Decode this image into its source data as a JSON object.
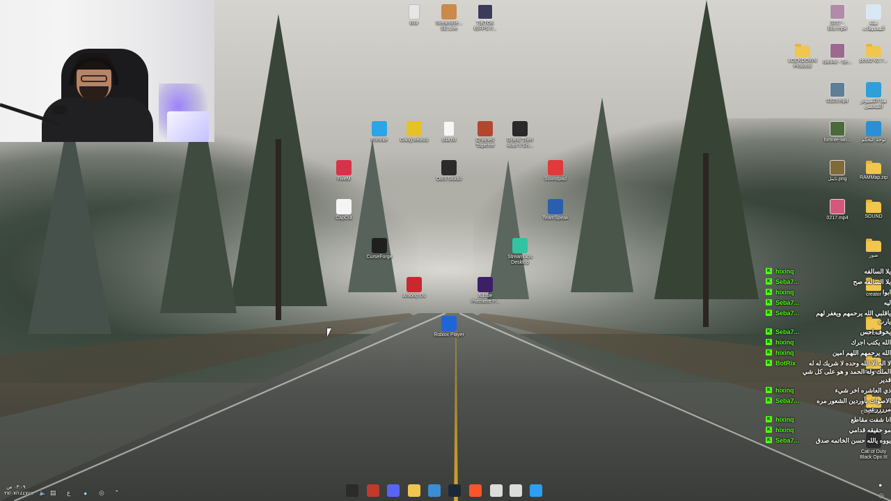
{
  "desktop": {
    "icons": [
      {
        "label": "Blur",
        "kind": "doc",
        "color": "#e6e6e6"
      },
      {
        "label": "StreamEle...\nSE.Live",
        "kind": "app",
        "color": "#c98a4a"
      },
      {
        "label": "TIKTOK\n60FPS F...",
        "kind": "vid",
        "color": "#3b3b5a"
      },
      {
        "label": "0217 -\nBlur.mp4",
        "kind": "vid",
        "color": "#b08ca8"
      },
      {
        "label": "سلة\nالمحذوفات",
        "kind": "app",
        "color": "#d9e8f2"
      },
      {
        "label": "LOCKDOWN\nProtocol",
        "kind": "folder",
        "color": "#f0c64e"
      },
      {
        "label": "dani4x - Se...",
        "kind": "vid",
        "color": "#9c6a8f"
      },
      {
        "label": "pcsx2-v2.7...",
        "kind": "folder",
        "color": "#f0c64e"
      },
      {
        "label": "0223.mp4",
        "kind": "vid",
        "color": "#5e7f95"
      },
      {
        "label": "هذا الكمبيوتر\nالشخصي",
        "kind": "app",
        "color": "#2f9fd8"
      },
      {
        "label": "Fortnite",
        "kind": "app",
        "color": "#2aa5e8"
      },
      {
        "label": "Gang Beasts",
        "kind": "app",
        "color": "#e7c227"
      },
      {
        "label": "sda.txt",
        "kind": "doc",
        "color": "#f7f7f7"
      },
      {
        "label": "Chained\nTogether",
        "kind": "app",
        "color": "#b3472e"
      },
      {
        "label": "Grand Theft\nAuto V En...",
        "kind": "app",
        "color": "#2a2a2a"
      },
      {
        "label": "fortnite-lan...",
        "kind": "vid",
        "color": "#4b6a3a"
      },
      {
        "label": "لوحة التحكم",
        "kind": "app",
        "color": "#2a8fd6"
      },
      {
        "label": "FiveM",
        "kind": "app",
        "color": "#d8324a"
      },
      {
        "label": "OBS Studio",
        "kind": "app",
        "color": "#2b2b2b"
      },
      {
        "label": "Soundpad",
        "kind": "app",
        "color": "#e03a3a"
      },
      {
        "label": "تايتل.png",
        "kind": "vid",
        "color": "#7f6a3a"
      },
      {
        "label": "RAMMap.zip",
        "kind": "folder",
        "color": "#f0c64e"
      },
      {
        "label": "CapCut",
        "kind": "app",
        "color": "#f4f4f4"
      },
      {
        "label": "TeamSpeak",
        "kind": "app",
        "color": "#2b5fae"
      },
      {
        "label": "0217.mp4",
        "kind": "vid",
        "color": "#d5577b"
      },
      {
        "label": "SOUND",
        "kind": "folder",
        "color": "#f0c64e"
      },
      {
        "label": "CurseForge",
        "kind": "app",
        "color": "#1f1f1f"
      },
      {
        "label": "Streamlabs\nDesktop",
        "kind": "app",
        "color": "#31c3a2"
      },
      {
        "label": "صور",
        "kind": "folder",
        "color": "#f0c64e"
      },
      {
        "label": "Among Us",
        "kind": "app",
        "color": "#c8282e"
      },
      {
        "label": "Adobe\nPremiere P...",
        "kind": "app",
        "color": "#3d1f66"
      },
      {
        "label": "creator",
        "kind": "folder",
        "color": "#f0c64e"
      },
      {
        "label": "Roblox Player",
        "kind": "app",
        "color": "#1f64d9"
      },
      {
        "label": "photo",
        "kind": "folder",
        "color": "#f0c64e"
      },
      {
        "label": "Program",
        "kind": "folder",
        "color": "#f0c64e"
      },
      {
        "label": "صور للمونتاج",
        "kind": "folder",
        "color": "#f0c64e"
      },
      {
        "label": "Call of Duty\nBlack Ops III",
        "kind": "app",
        "color": "#2c2c2c"
      }
    ]
  },
  "chat": {
    "messages": [
      {
        "badge": "K",
        "user": "hixinq",
        "text": "يلا السالفه"
      },
      {
        "badge": "K",
        "user": "Seba7...",
        "text": "يلا السالفه صح"
      },
      {
        "badge": "K",
        "user": "hixinq",
        "text": "ابوا"
      },
      {
        "badge": "K",
        "user": "Seba7...",
        "text": "ليه"
      },
      {
        "badge": "K",
        "user": "Seba7...",
        "text": "ياقلبي الله يرحمهم ويغفر لهم يارب"
      },
      {
        "badge": "K",
        "user": "Seba7...",
        "text": "يخوف احس"
      },
      {
        "badge": "K",
        "user": "hixinq",
        "text": "الله يكتب اجرك"
      },
      {
        "badge": "K",
        "user": "hixinq",
        "text": "الله يرحمهم اللهم امين"
      },
      {
        "badge": "K",
        "user": "BotRix",
        "text": "لا اله الا الله وحده لا شريك له له الملك وله الحمد و هو على كل شي قدير"
      },
      {
        "badge": "K",
        "user": "hixinq",
        "text": "ذي العاشره اخر شيء"
      },
      {
        "badge": "K",
        "user": "Seba7...",
        "text": "الاصوات بأوردين الشعور مره مررررعب"
      },
      {
        "badge": "K",
        "user": "hixinq",
        "text": "انا شفت مقاطع"
      },
      {
        "badge": "K",
        "user": "hixinq",
        "text": "مو حقيقه قدامي"
      },
      {
        "badge": "K",
        "user": "Seba7...",
        "text": "يووه يالله حسن الخاتمه صدق"
      }
    ]
  },
  "taskbar": {
    "clock_time": "٠٣:٠٩ ص",
    "clock_date": "٢٧/٠٧/١٤٤٧",
    "tray_lang": "ع",
    "pinned": [
      {
        "name": "obs",
        "color": "#2b2b2b"
      },
      {
        "name": "gta",
        "color": "#c0392b"
      },
      {
        "name": "discord",
        "color": "#5865f2"
      },
      {
        "name": "explorer",
        "color": "#f0c64e"
      },
      {
        "name": "store",
        "color": "#3b8ed6"
      },
      {
        "name": "steam",
        "color": "#1b2838"
      },
      {
        "name": "brave",
        "color": "#fb542b"
      },
      {
        "name": "task-view",
        "color": "#dcdcdc"
      },
      {
        "name": "search",
        "color": "#dcdcdc"
      },
      {
        "name": "start",
        "color": "#2c9ff0"
      }
    ]
  }
}
